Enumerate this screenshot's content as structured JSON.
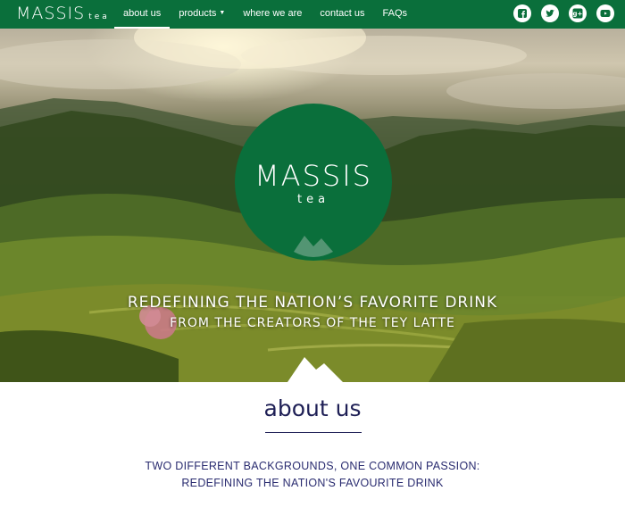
{
  "brand": {
    "name": "MASSIS",
    "sub": "tea"
  },
  "nav": {
    "items": [
      {
        "label": "about us",
        "active": true
      },
      {
        "label": "products",
        "dropdown": true
      },
      {
        "label": "where we are"
      },
      {
        "label": "contact us"
      },
      {
        "label": "FAQs"
      }
    ],
    "social": [
      "facebook-icon",
      "twitter-icon",
      "google-plus-icon",
      "youtube-icon"
    ]
  },
  "hero": {
    "logo_main": "MASSIS",
    "logo_sub": "tea",
    "headline": "REDEFINING THE NATION’S FAVORITE DRINK",
    "subheadline": "FROM THE CREATORS OF THE TEY LATTE"
  },
  "about": {
    "title": "about us",
    "line1": "TWO DIFFERENT BACKGROUNDS, ONE COMMON PASSION:",
    "line2": "REDEFINING THE NATION'S FAVOURITE DRINK"
  },
  "colors": {
    "brand_green": "#0a6f3b",
    "navy": "#1e1f55"
  }
}
